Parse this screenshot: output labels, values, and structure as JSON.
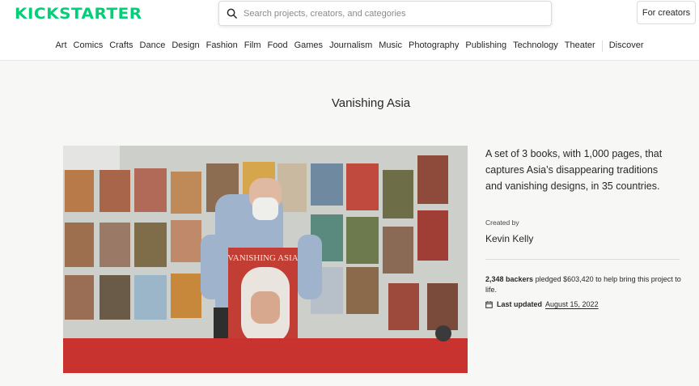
{
  "header": {
    "logo": "KICKSTARTER",
    "search_placeholder": "Search projects, creators, and categories",
    "for_creators": "For creators"
  },
  "nav": {
    "categories": [
      "Art",
      "Comics",
      "Crafts",
      "Dance",
      "Design",
      "Fashion",
      "Film",
      "Food",
      "Games",
      "Journalism",
      "Music",
      "Photography",
      "Publishing",
      "Technology",
      "Theater"
    ],
    "discover": "Discover"
  },
  "project": {
    "title": "Vanishing Asia",
    "blurb": "A set of 3 books, with 1,000 pages, that captures Asia’s disappearing traditions and vanishing designs, in 35 countries.",
    "created_by_label": "Created by",
    "creator": "Kevin Kelly",
    "backers_count": "2,348 backers",
    "backers_rest": "pledged $603,420 to help bring this project to life.",
    "last_updated_label": "Last updated",
    "last_updated_date": "August 15, 2022"
  },
  "video": {
    "book_title": "VANISHING ASIA"
  },
  "colors": {
    "brand_green": "#05ce78",
    "page_bg": "#f7f7f6",
    "text": "#282828"
  }
}
